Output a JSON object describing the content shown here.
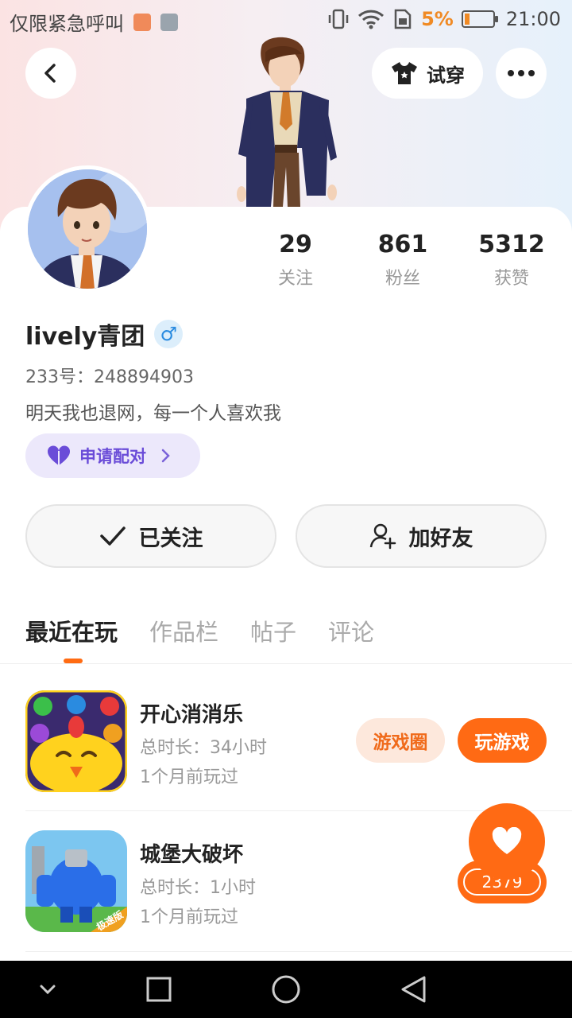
{
  "status_bar": {
    "carrier": "仅限紧急呼叫",
    "battery_percent": "5%",
    "time": "21:00"
  },
  "header": {
    "try_on_label": "试穿"
  },
  "profile": {
    "stats": [
      {
        "value": "29",
        "label": "关注"
      },
      {
        "value": "861",
        "label": "粉丝"
      },
      {
        "value": "5312",
        "label": "获赞"
      }
    ],
    "name": "lively青团",
    "gender_symbol": "♂",
    "id_line": "233号：248894903",
    "bio": "明天我也退网，每一个人喜欢我",
    "pair_label": "申请配对"
  },
  "actions": {
    "follow_label": "已关注",
    "add_friend_label": "加好友"
  },
  "tabs": [
    "最近在玩",
    "作品栏",
    "帖子",
    "评论"
  ],
  "games": [
    {
      "name": "开心消消乐",
      "duration": "总时长：34小时",
      "last_played": "1个月前玩过",
      "circle_label": "游戏圈",
      "play_label": "玩游戏"
    },
    {
      "name": "城堡大破坏",
      "duration": "总时长：1小时",
      "last_played": "1个月前玩过",
      "badge": "极速版"
    }
  ],
  "like_fab": {
    "count": "2379"
  },
  "colors": {
    "accent": "#ff6a14",
    "pair_purple": "#6a4cd8"
  }
}
